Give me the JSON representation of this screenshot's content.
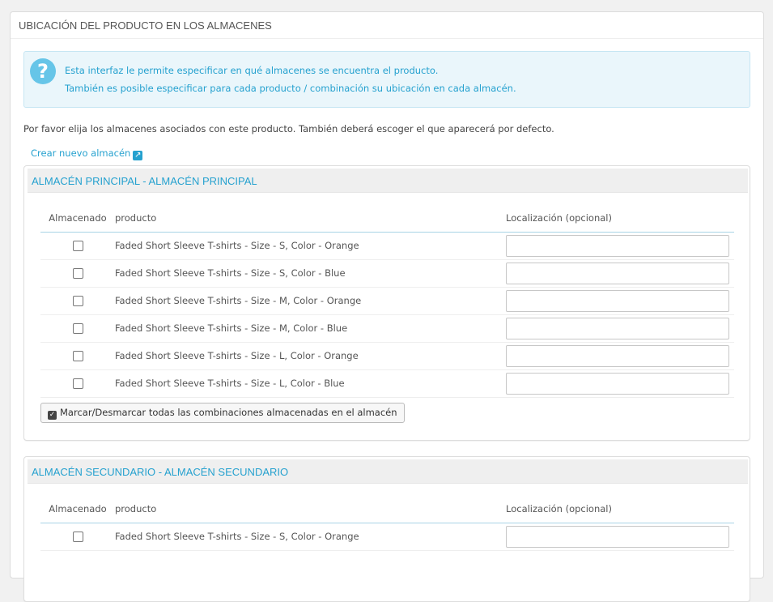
{
  "panel": {
    "title": "UBICACIÓN DEL PRODUCTO EN LOS ALMACENES"
  },
  "alert": {
    "icon": "question-circle-icon",
    "line1": "Esta interfaz le permite especificar en qué almacenes se encuentra el producto.",
    "line2": "También es posible especificar para cada producto / combinación su ubicación en cada almacén."
  },
  "intro_text": "Por favor elija los almacenes asociados con este producto. También deberá escoger el que aparecerá por defecto.",
  "create_link": {
    "label": "Crear nuevo almacén",
    "icon": "external-link-icon"
  },
  "columns": {
    "stored": "Almacenado",
    "product": "producto",
    "location": "Localización (opcional)"
  },
  "warehouses": [
    {
      "title": "ALMACÉN PRINCIPAL - ALMACÉN PRINCIPAL",
      "rows": [
        {
          "product": "Faded Short Sleeve T-shirts - Size - S, Color - Orange",
          "checked": false,
          "location": ""
        },
        {
          "product": "Faded Short Sleeve T-shirts - Size - S, Color - Blue",
          "checked": false,
          "location": ""
        },
        {
          "product": "Faded Short Sleeve T-shirts - Size - M, Color - Orange",
          "checked": false,
          "location": ""
        },
        {
          "product": "Faded Short Sleeve T-shirts - Size - M, Color - Blue",
          "checked": false,
          "location": ""
        },
        {
          "product": "Faded Short Sleeve T-shirts - Size - L, Color - Orange",
          "checked": false,
          "location": ""
        },
        {
          "product": "Faded Short Sleeve T-shirts - Size - L, Color - Blue",
          "checked": false,
          "location": ""
        }
      ],
      "toggle_all_label": "Marcar/Desmarcar todas las combinaciones almacenadas en el almacén"
    },
    {
      "title": "ALMACÉN SECUNDARIO - ALMACÉN SECUNDARIO",
      "rows": [
        {
          "product": "Faded Short Sleeve T-shirts - Size - S, Color - Orange",
          "checked": false,
          "location": ""
        }
      ]
    }
  ],
  "colors": {
    "accent": "#25a1cf",
    "alert_bg": "#eaf6fb",
    "heading_bg": "#efefef"
  }
}
